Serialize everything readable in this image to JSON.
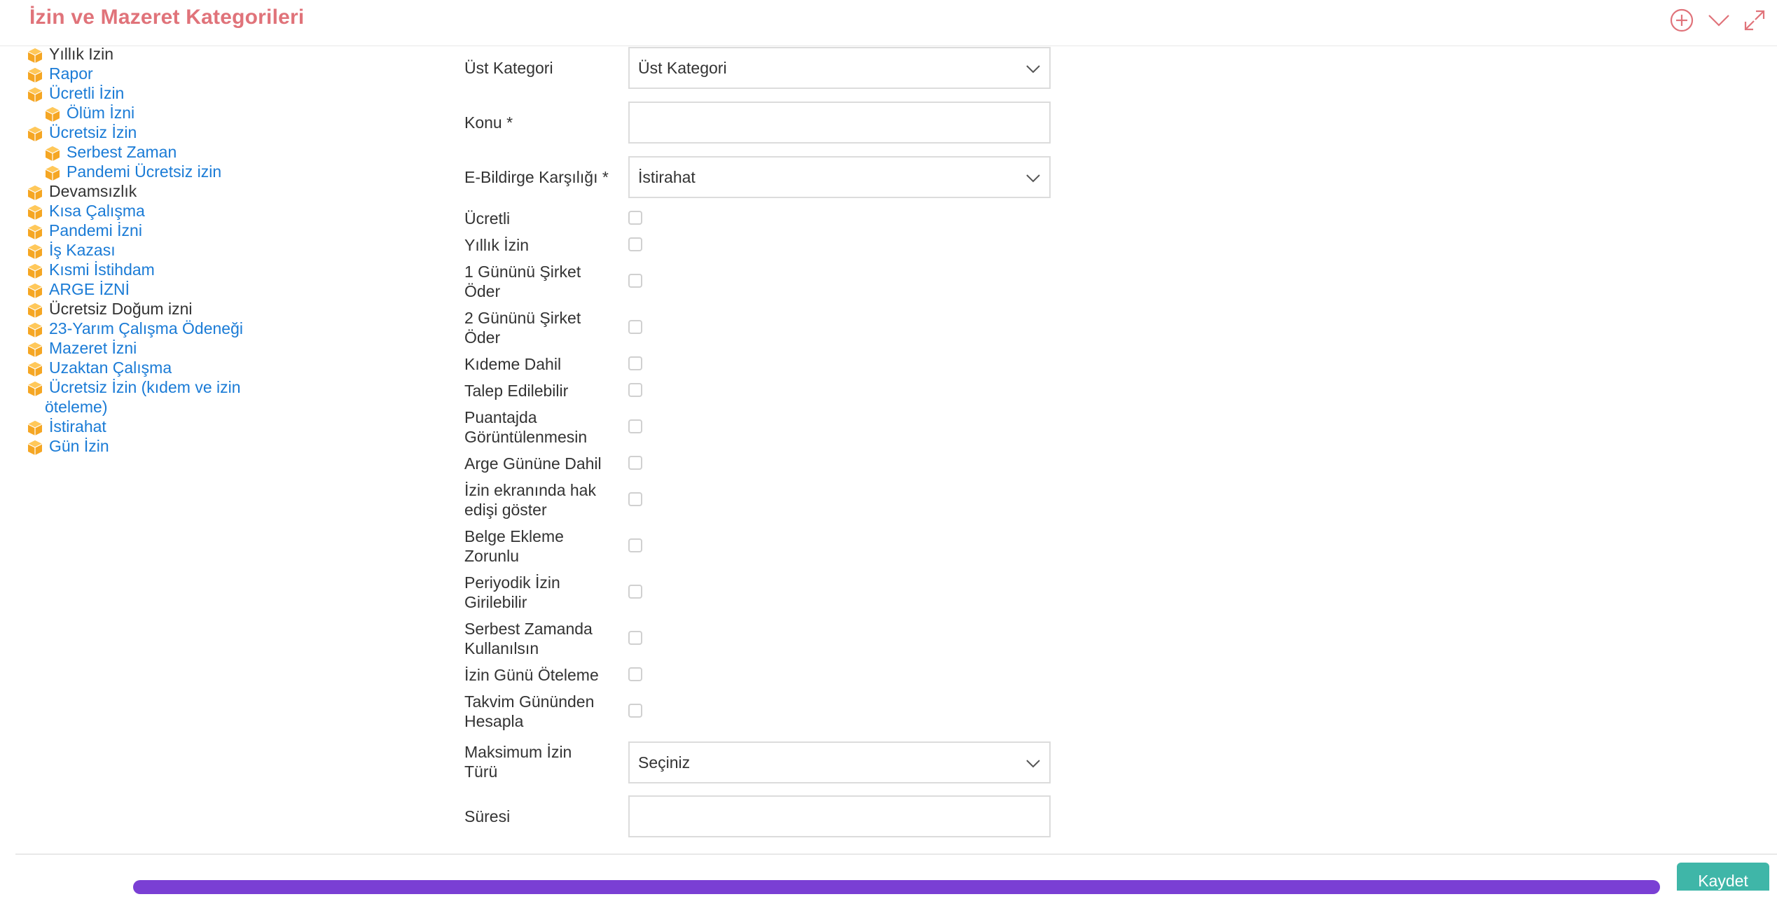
{
  "header": {
    "title": "İzin ve Mazeret Kategorileri",
    "accent_color": "#e0737a",
    "icons": [
      "add-circle-icon",
      "chevron-down-icon",
      "expand-icon"
    ]
  },
  "tree": {
    "items": [
      {
        "label": "Yıllık Izin",
        "link": false,
        "level": 0
      },
      {
        "label": "Rapor",
        "link": true,
        "level": 0
      },
      {
        "label": "Ücretli İzin",
        "link": true,
        "level": 0
      },
      {
        "label": "Ölüm İzni",
        "link": true,
        "level": 1
      },
      {
        "label": "Ücretsiz İzin",
        "link": true,
        "level": 0
      },
      {
        "label": "Serbest Zaman",
        "link": true,
        "level": 1
      },
      {
        "label": "Pandemi Ücretsiz izin",
        "link": true,
        "level": 1
      },
      {
        "label": "Devamsızlık",
        "link": false,
        "level": 0
      },
      {
        "label": "Kısa Çalışma",
        "link": true,
        "level": 0
      },
      {
        "label": "Pandemi İzni",
        "link": true,
        "level": 0
      },
      {
        "label": "İş Kazası",
        "link": true,
        "level": 0
      },
      {
        "label": "Kısmi İstihdam",
        "link": true,
        "level": 0
      },
      {
        "label": "ARGE İZNİ",
        "link": true,
        "level": 0
      },
      {
        "label": "Ücretsiz Doğum izni",
        "link": false,
        "level": 0
      },
      {
        "label": "23-Yarım Çalışma Ödeneği",
        "link": true,
        "level": 0
      },
      {
        "label": "Mazeret İzni",
        "link": true,
        "level": 0
      },
      {
        "label": "Uzaktan Çalışma",
        "link": true,
        "level": 0
      },
      {
        "label": "Ücretsiz İzin (kıdem ve izin",
        "label2": "öteleme)",
        "link": true,
        "level": 0
      },
      {
        "label": "İstirahat",
        "link": true,
        "level": 0
      },
      {
        "label": "Gün İzin",
        "link": true,
        "level": 0
      }
    ],
    "icon_color": "#f5a623",
    "link_color": "#1a7bd6"
  },
  "form": {
    "ust_kategori": {
      "label": "Üst Kategori",
      "value": "Üst Kategori"
    },
    "konu": {
      "label": "Konu *",
      "value": ""
    },
    "ebildirge": {
      "label": "E-Bildirge Karşılığı *",
      "value": "İstirahat"
    },
    "checks": {
      "c1": {
        "label": "Ücretli"
      },
      "c2": {
        "label": "Yıllık İzin"
      },
      "c3": {
        "label_1": "1 Gününü Şirket",
        "label_2": "Öder"
      },
      "c4": {
        "label_1": "2 Gününü Şirket",
        "label_2": "Öder"
      },
      "c5": {
        "label": "Kıdeme Dahil"
      },
      "c6": {
        "label": "Talep Edilebilir"
      },
      "c7": {
        "label_1": "Puantajda",
        "label_2": "Görüntülenmesin"
      },
      "c8": {
        "label": "Arge Gününe Dahil"
      },
      "c9": {
        "label_1": "İzin ekranında hak",
        "label_2": "edişi göster"
      },
      "c10": {
        "label_1": "Belge Ekleme",
        "label_2": "Zorunlu"
      },
      "c11": {
        "label_1": "Periyodik İzin",
        "label_2": "Girilebilir"
      },
      "c12": {
        "label_1": "Serbest Zamanda",
        "label_2": "Kullanılsın"
      },
      "c13": {
        "label": "İzin Günü Öteleme"
      },
      "c14": {
        "label_1": "Takvim Gününden",
        "label_2": "Hesapla"
      }
    },
    "maks_izin": {
      "label_1": "Maksimum İzin",
      "label_2": "Türü",
      "value": "Seçiniz"
    },
    "suresi": {
      "label": "Süresi",
      "value": ""
    }
  },
  "footer": {
    "save_label": "Kaydet",
    "save_color": "#3fb6a8"
  }
}
